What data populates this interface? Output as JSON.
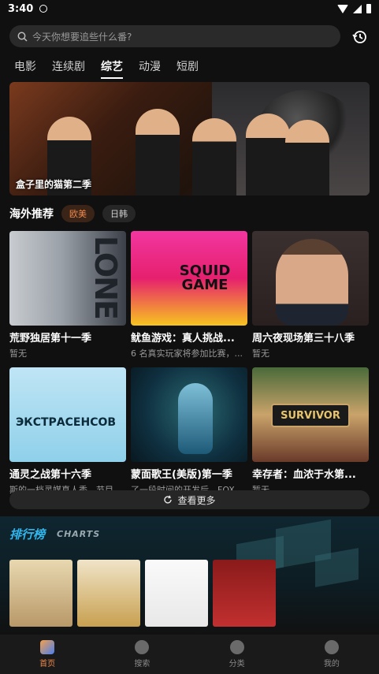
{
  "status_bar": {
    "time": "3:40"
  },
  "search": {
    "placeholder": "今天你想要追些什么番?"
  },
  "tabs": [
    {
      "label": "电影"
    },
    {
      "label": "连续剧"
    },
    {
      "label": "综艺"
    },
    {
      "label": "动漫"
    },
    {
      "label": "短剧"
    }
  ],
  "banner": {
    "title": "盒子里的猫第二季"
  },
  "overseas": {
    "title": "海外推荐",
    "chips": [
      {
        "label": "欧美"
      },
      {
        "label": "日韩"
      }
    ],
    "items": [
      {
        "title": "荒野独居第十一季",
        "subtitle": "暂无",
        "poster_text": "LONE"
      },
      {
        "title": "鱿鱼游戏：真人挑战...",
        "subtitle": "6 名真实玩家将参加比赛，...",
        "poster_text": "SQUID GAME"
      },
      {
        "title": "周六夜现场第三十八季",
        "subtitle": "暂无"
      },
      {
        "title": "通灵之战第十六季",
        "subtitle": "斯的一档灵媒真人秀。节目...",
        "poster_text": "ЭКСТРАСЕНСОВ"
      },
      {
        "title": "蒙面歌王(美版)第一季",
        "subtitle": "了一段时间的开发后，FOX..."
      },
      {
        "title": "幸存者：血浓于水第...",
        "subtitle": "暂无",
        "poster_text": "SURVIVOR"
      }
    ],
    "more_label": "查看更多"
  },
  "charts": {
    "title": "排行榜",
    "title_en": "CHARTS"
  },
  "bottom_nav": [
    {
      "label": "首页"
    },
    {
      "label": "搜索"
    },
    {
      "label": "分类"
    },
    {
      "label": "我的"
    }
  ],
  "colors": {
    "accent": "#f08a4b",
    "background": "#101010"
  }
}
